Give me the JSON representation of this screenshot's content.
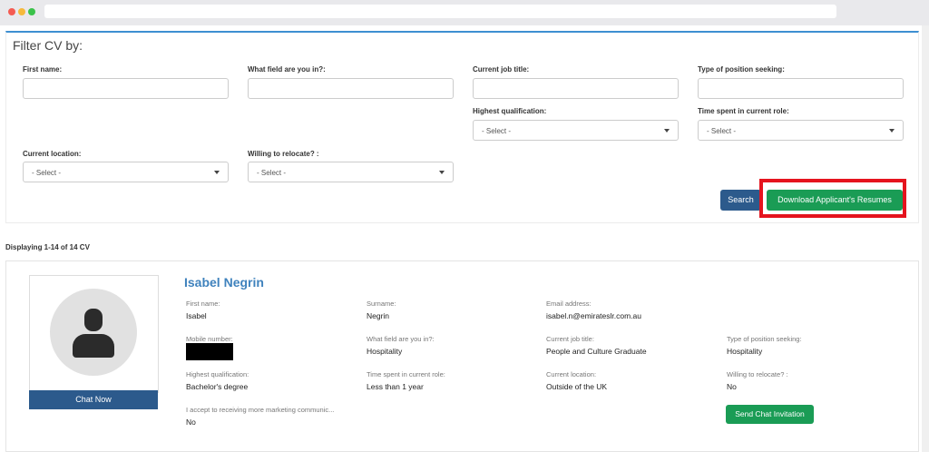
{
  "filter": {
    "title": "Filter CV by:",
    "first_name_label": "First name:",
    "field_label": "What field are you in?:",
    "job_title_label": "Current job title:",
    "position_label": "Type of position seeking:",
    "qualification_label": "Highest qualification:",
    "time_label": "Time spent in current role:",
    "location_label": "Current location:",
    "relocate_label": "Willing to relocate? :",
    "select_placeholder": "- Select -",
    "search_button": "Search",
    "download_button": "Download Applicant's Resumes"
  },
  "results": {
    "count_text": "Displaying 1-14 of 14 CV"
  },
  "candidate": {
    "name": "Isabel Negrin",
    "chat_button": "Chat Now",
    "invite_button": "Send Chat Invitation",
    "first_name_label": "First name:",
    "first_name": "Isabel",
    "surname_label": "Surname:",
    "surname": "Negrin",
    "email_label": "Email address:",
    "email": "isabel.n@emirateslr.com.au",
    "mobile_label": "Mobile number:",
    "field_label": "What field are you in?:",
    "field": "Hospitality",
    "job_title_label": "Current job title:",
    "job_title": "People and Culture Graduate",
    "position_label": "Type of position seeking:",
    "position": "Hospitality",
    "qualification_label": "Highest qualification:",
    "qualification": "Bachelor's degree",
    "time_label": "Time spent in current role:",
    "time": "Less than 1 year",
    "location_label": "Current location:",
    "location": "Outside of the UK",
    "relocate_label": "Willing to relocate? :",
    "relocate": "No",
    "marketing_label": "I accept to receiving more marketing communic...",
    "marketing": "No"
  },
  "colors": {
    "accent_blue": "#2c5a8c",
    "accent_green": "#1a9c55",
    "highlight_red": "#e5141e",
    "name_blue": "#3f82bd"
  }
}
